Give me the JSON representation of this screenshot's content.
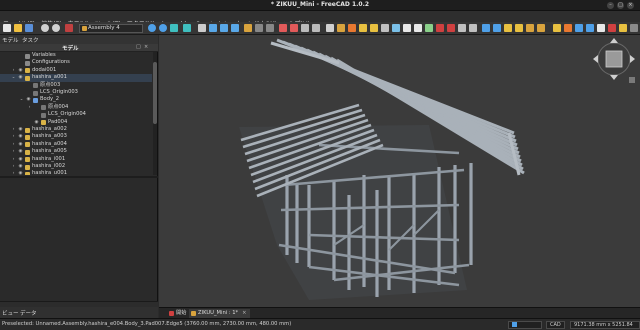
{
  "window": {
    "title": "* ZIKUU_Mini - FreeCAD 1.0.2"
  },
  "menu": [
    "ファイル(F)",
    "編集(E)",
    "表示(V)",
    "ツール(T)",
    "マクロ(M)",
    "Assembly",
    "Constraints",
    "ウィンドウ(W)",
    "ヘルプ(H)"
  ],
  "toolbar": {
    "workbench": "Assembly 4"
  },
  "panel": {
    "tabs": [
      "モデル",
      "タスク"
    ],
    "header": "モデル",
    "bottom_tabs": [
      "ビュー",
      "データ"
    ]
  },
  "tree": [
    {
      "label": "Variables",
      "indent": 0,
      "color": "#8a8a8a",
      "arrow": "",
      "eye": false
    },
    {
      "label": "Configurations",
      "indent": 0,
      "color": "#8a8a8a",
      "arrow": "",
      "eye": false
    },
    {
      "label": "dodai001",
      "indent": 0,
      "color": "#d9b347",
      "arrow": "›",
      "eye": true
    },
    {
      "label": "hashira_a001",
      "indent": 0,
      "color": "#d9b347",
      "arrow": "⌄",
      "eye": true
    },
    {
      "label": "原点003",
      "indent": 1,
      "color": "#777777",
      "arrow": "",
      "eye": false
    },
    {
      "label": "LCS_Origin003",
      "indent": 1,
      "color": "#777777",
      "arrow": "",
      "eye": false
    },
    {
      "label": "Body_2",
      "indent": 1,
      "color": "#6a9ee0",
      "arrow": "⌄",
      "eye": true
    },
    {
      "label": "原点004",
      "indent": 2,
      "color": "#777777",
      "arrow": "›",
      "eye": false
    },
    {
      "label": "LCS_Origin004",
      "indent": 2,
      "color": "#777777",
      "arrow": "",
      "eye": false
    },
    {
      "label": "Pad004",
      "indent": 2,
      "color": "#d9b347",
      "arrow": "",
      "eye": true
    },
    {
      "label": "hashira_a002",
      "indent": 0,
      "color": "#d9b347",
      "arrow": "›",
      "eye": true
    },
    {
      "label": "hashira_a003",
      "indent": 0,
      "color": "#d9b347",
      "arrow": "›",
      "eye": true
    },
    {
      "label": "hashira_a004",
      "indent": 0,
      "color": "#d9b347",
      "arrow": "›",
      "eye": true
    },
    {
      "label": "hashira_a005",
      "indent": 0,
      "color": "#d9b347",
      "arrow": "›",
      "eye": true
    },
    {
      "label": "hashira_i001",
      "indent": 0,
      "color": "#d9b347",
      "arrow": "›",
      "eye": true
    },
    {
      "label": "hashira_i002",
      "indent": 0,
      "color": "#d9b347",
      "arrow": "›",
      "eye": true
    },
    {
      "label": "hashira_u001",
      "indent": 0,
      "color": "#d9b347",
      "arrow": "›",
      "eye": true
    }
  ],
  "doc_tabs": [
    "開始",
    "ZIKUU_Mini : 1*"
  ],
  "status": {
    "message": "Preselected: Unnamed.Assembly.hashira_e004.Body_3.Pad007.Edge5 (3760.00 mm, 2730.00 mm, 480.00 mm)",
    "units": "CAD",
    "dimensions": "9171.38 mm x 5251.84 mm"
  },
  "colors": {
    "accent": "#d9b347",
    "viewport_bg": "#3b3b3b",
    "frame": "#9aa3ad"
  }
}
